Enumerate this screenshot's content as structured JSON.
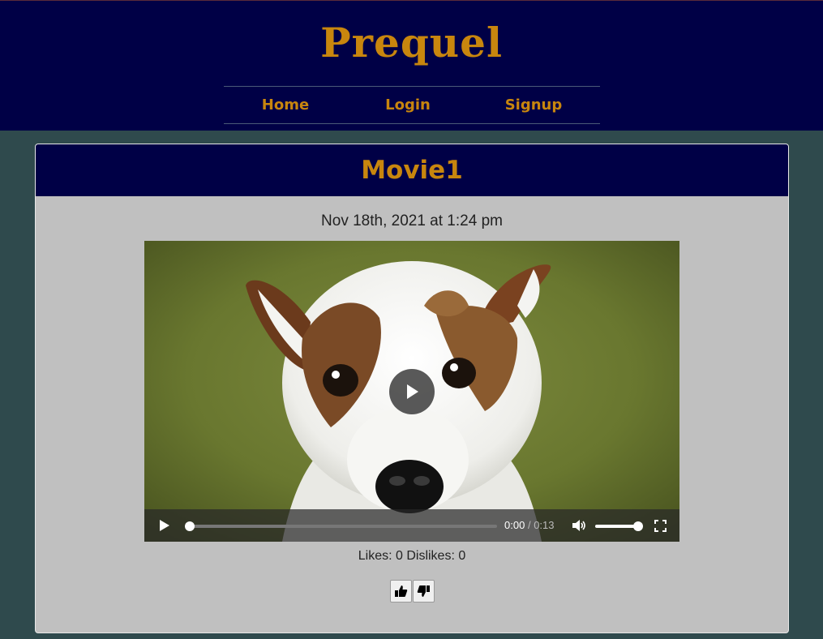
{
  "header": {
    "brand": "Prequel",
    "nav": [
      {
        "label": "Home"
      },
      {
        "label": "Login"
      },
      {
        "label": "Signup"
      }
    ]
  },
  "post": {
    "title": "Movie1",
    "date": "Nov 18th, 2021 at 1:24 pm",
    "video": {
      "current_time": "0:00",
      "separator": "/",
      "duration": "0:13",
      "progress_fraction": 0,
      "volume_fraction": 1.0
    },
    "stats": "Likes: 0 Dislikes: 0"
  },
  "colors": {
    "header_bg": "#000046",
    "accent": "#c8860e",
    "page_bg": "#2f4a4d",
    "card_bg": "#c0c0c0"
  },
  "icons": [
    "play-icon",
    "volume-icon",
    "fullscreen-icon",
    "thumbs-up-icon",
    "thumbs-down-icon"
  ]
}
